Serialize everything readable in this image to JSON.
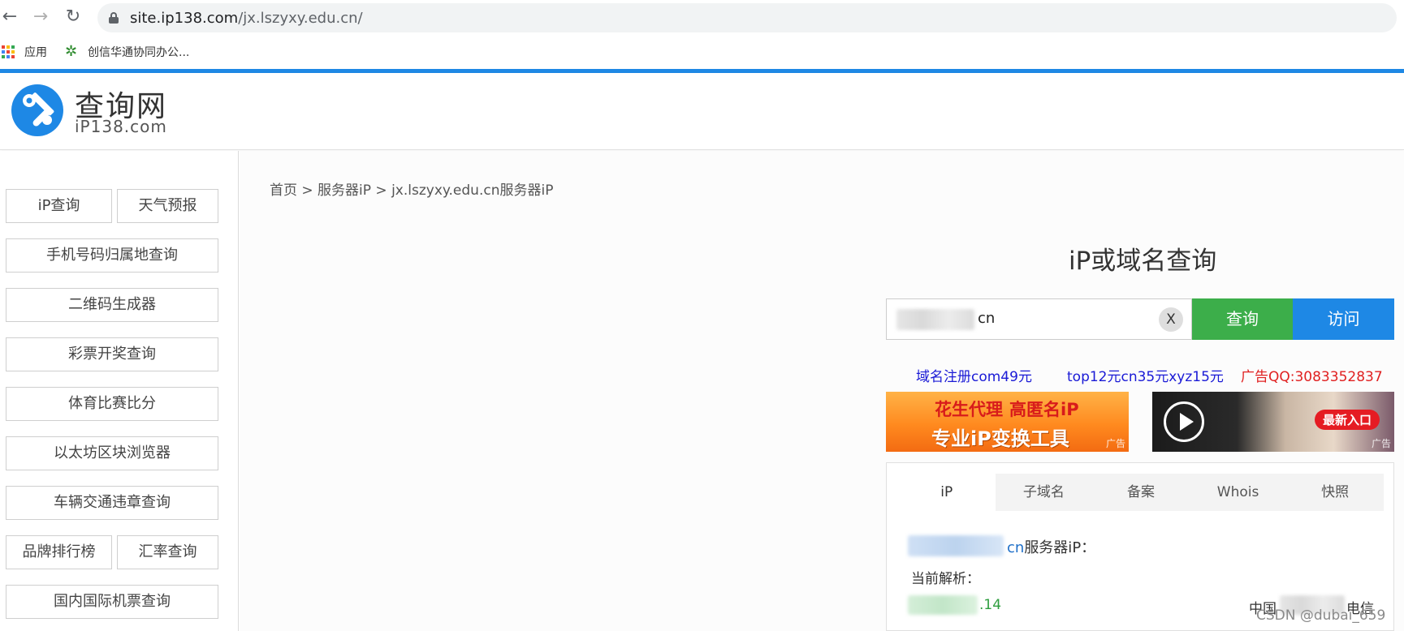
{
  "browser": {
    "url_host": "site.ip138.com",
    "url_path": "/jx.lszyxy.edu.cn/",
    "back_icon": "←",
    "forward_icon": "→",
    "reload_icon": "↻"
  },
  "bookmarks": [
    {
      "label": "应用",
      "icon": "apps-grid-icon"
    },
    {
      "label": "创信华通协同办公...",
      "icon": "gear-icon"
    }
  ],
  "header": {
    "logo_title": "查询网",
    "logo_sub": "iP138.com",
    "brand_color": "#1e88e5"
  },
  "sidebar": {
    "items": [
      {
        "label": "iP查询"
      },
      {
        "label": "天气预报"
      },
      {
        "label": "手机号码归属地查询"
      },
      {
        "label": "二维码生成器"
      },
      {
        "label": "彩票开奖查询"
      },
      {
        "label": "体育比赛比分"
      },
      {
        "label": "以太坊区块浏览器"
      },
      {
        "label": "车辆交通违章查询"
      },
      {
        "label": "品牌排行榜"
      },
      {
        "label": "汇率查询"
      },
      {
        "label": "国内国际机票查询"
      }
    ]
  },
  "breadcrumb": {
    "text": "首页 > 服务器iP > jx.lszyxy.edu.cn服务器iP"
  },
  "query": {
    "title": "iP或域名查询",
    "input_value_visible": "cn",
    "clear_label": "X",
    "query_label": "查询",
    "visit_label": "访问",
    "query_color": "#3cae4a",
    "visit_color": "#1e88e5"
  },
  "ads": {
    "links": [
      {
        "text": "域名注册com49元",
        "color": "#1a1ad6"
      },
      {
        "text": "top12元cn35元xyz15元",
        "color": "#1a1ad6"
      },
      {
        "text": "广告QQ:3083352837",
        "color": "#e02020"
      }
    ],
    "banner1": {
      "line1a": "花生代理",
      "line1b": "高匿名iP",
      "line2": "专业iP变换工具",
      "tag": "广告"
    },
    "banner2": {
      "badge": "最新入口",
      "tag": "广告"
    }
  },
  "panel": {
    "tabs": [
      {
        "label": "iP",
        "active": true
      },
      {
        "label": "子域名"
      },
      {
        "label": "备案"
      },
      {
        "label": "Whois"
      },
      {
        "label": "快照"
      }
    ],
    "result_domain_visible": "cn",
    "result_suffix": "服务器iP：",
    "current_label": "当前解析：",
    "ip_tail": ".14",
    "isp_a": "中国",
    "isp_b": "电信"
  },
  "watermark": "CSDN @dubai_659"
}
